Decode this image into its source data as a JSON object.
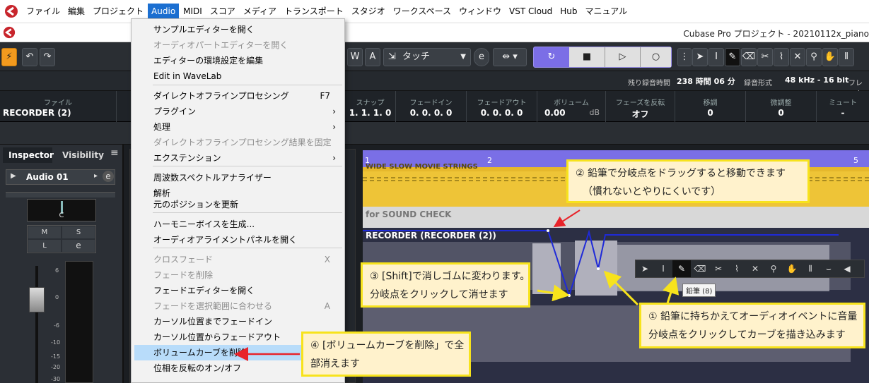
{
  "menubar": {
    "items": [
      "ファイル",
      "編集",
      "プロジェクト",
      "Audio",
      "MIDI",
      "スコア",
      "メディア",
      "トランスポート",
      "スタジオ",
      "ワークスペース",
      "ウィンドウ",
      "VST Cloud",
      "Hub",
      "マニュアル"
    ],
    "active_index": 3
  },
  "titlebar": {
    "title": "Cubase Pro プロジェクト - 20210112x_piano"
  },
  "toolbar": {
    "write_label": "W",
    "read_label": "A",
    "automation_mode": "タッチ",
    "e_label": "e"
  },
  "status": {
    "remaining_label": "残り録音時間",
    "remaining_value": "238 時間 06 分",
    "format_label": "録音形式",
    "format_value": "48 kHz - 16 bit",
    "frame_label": "フレーム"
  },
  "infoline": {
    "file_header": "ファイル",
    "file_value": "RECORDER (2)",
    "snap_header": "スナップ",
    "snap_value": "1. 1. 1.   0",
    "fadein_header": "フェードイン",
    "fadein_value": "0. 0. 0.   0",
    "fadeout_header": "フェードアウト",
    "fadeout_value": "0. 0. 0.   0",
    "volume_header": "ボリューム",
    "volume_value": "0.00",
    "volume_unit": "dB",
    "phase_header": "フェーズを反転",
    "phase_value": "オフ",
    "transpose_header": "移調",
    "transpose_value": "0",
    "fine_header": "微調整",
    "fine_value": "0",
    "mute_header": "ミュート",
    "mute_value": "-"
  },
  "inspector": {
    "tab_inspector": "Inspector",
    "tab_visibility": "Visibility",
    "track_name": "Audio 01",
    "pan_label": "C",
    "m_label": "M",
    "s_label": "S",
    "l_label": "L",
    "e_label": "e",
    "fader_scale": [
      "6",
      "0",
      "-6",
      "-10",
      "-15",
      "-20",
      "-30"
    ]
  },
  "arrange": {
    "ruler_marks": [
      "1",
      "2",
      "5"
    ],
    "track1_text": "WIDE SLOW MOVIE STRINGS",
    "track2_text": "for SOUND CHECK",
    "event_name": "RECORDER (RECORDER (2))"
  },
  "dropdown": {
    "items": [
      {
        "label": "サンプルエディターを開く",
        "disabled": false
      },
      {
        "label": "オーディオパートエディターを開く",
        "disabled": true
      },
      {
        "label": "エディターの環境設定を編集",
        "disabled": false
      },
      {
        "label": "Edit in WaveLab",
        "disabled": false
      },
      {
        "label": "ダイレクトオフラインプロセシング",
        "shortcut": "F7",
        "disabled": false
      },
      {
        "label": "プラグイン",
        "submenu": "›",
        "disabled": false
      },
      {
        "label": "処理",
        "submenu": "›",
        "disabled": false
      },
      {
        "label": "ダイレクトオフラインプロセシング結果を固定",
        "disabled": true
      },
      {
        "label": "エクステンション",
        "submenu": "›",
        "disabled": false
      },
      {
        "label": "周波数スペクトルアナライザー",
        "disabled": false
      },
      {
        "label": "解析",
        "disabled": false
      },
      {
        "label": "元のポジションを更新",
        "disabled": false
      },
      {
        "label": "ハーモニーボイスを生成...",
        "disabled": false
      },
      {
        "label": "オーディオアライメントパネルを開く",
        "disabled": false
      },
      {
        "label": "クロスフェード",
        "shortcut": "X",
        "disabled": true
      },
      {
        "label": "フェードを削除",
        "disabled": true
      },
      {
        "label": "フェードエディターを開く",
        "disabled": false
      },
      {
        "label": "フェードを選択範囲に合わせる",
        "shortcut": "A",
        "disabled": true
      },
      {
        "label": "カーソル位置までフェードイン",
        "disabled": false
      },
      {
        "label": "カーソル位置からフェードアウト",
        "disabled": false
      },
      {
        "label": "ボリュームカーブを削除",
        "disabled": false,
        "highlighted": true
      },
      {
        "label": "位相を反転のオン/オフ",
        "disabled": false
      }
    ]
  },
  "callouts": {
    "c1_line1": "① 鉛筆に持ちかえてオーディオイベントに音量",
    "c1_line2": "分岐点をクリックしてカーブを描き込みます",
    "c2_line1": "② 鉛筆で分岐点をドラッグすると移動できます",
    "c2_line2": "（慣れないとやりにくいです）",
    "c3_line1": "③ [Shift]で消しゴムに変わります。",
    "c3_line2": "分岐点をクリックして消せます",
    "c4_line1": "④ [ボリュームカーブを削除」で全",
    "c4_line2": "部消えます"
  },
  "tooltip": {
    "pencil": "鉛筆 (8)"
  },
  "colors": {
    "accent_blue": "#1b6fd1",
    "ruler_purple": "#7a6fe6",
    "callout_fill": "#fff2cc",
    "callout_border": "#f7e31c",
    "arrow_red": "#e8232a",
    "arrow_yellow": "#f7e31c",
    "volume_curve": "#1f2ad8"
  }
}
